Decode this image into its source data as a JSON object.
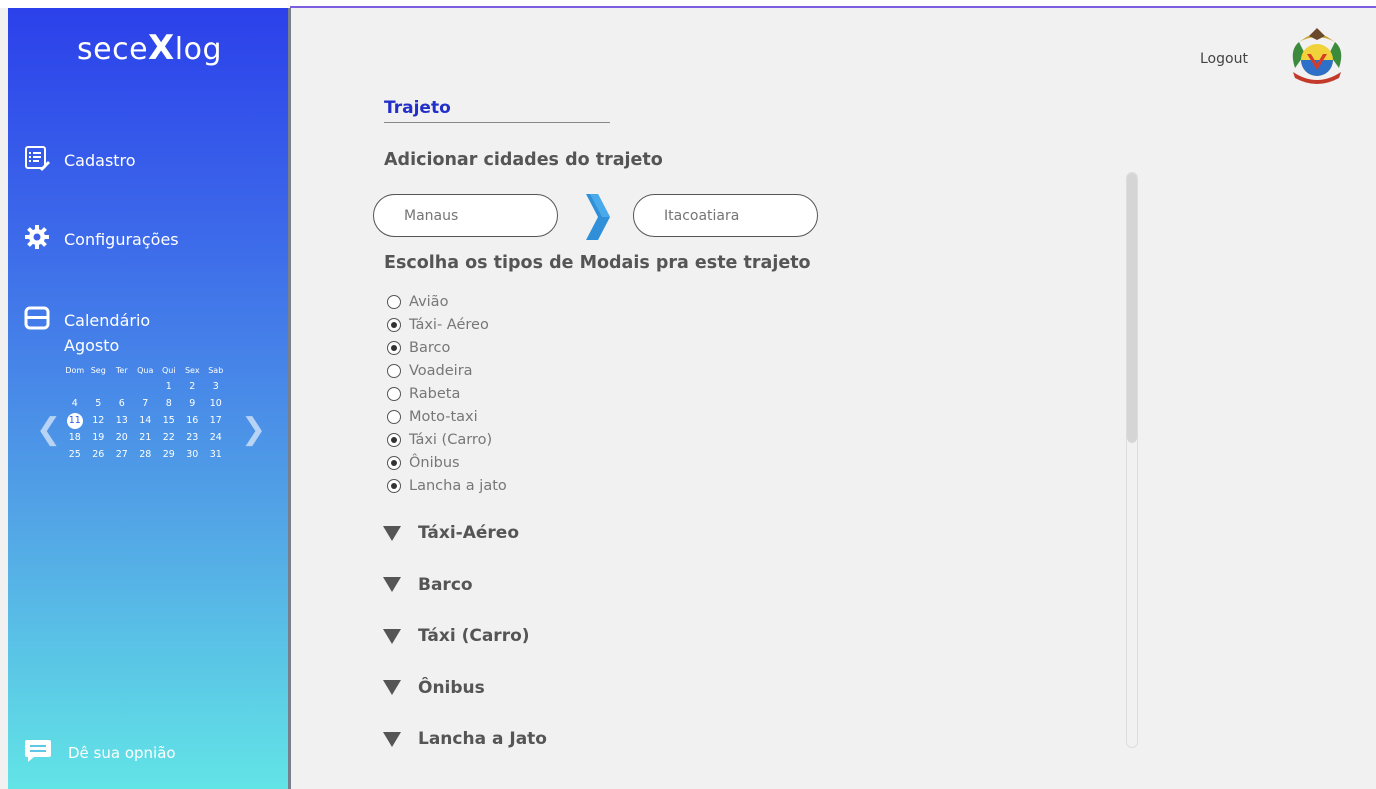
{
  "app": {
    "logo_prefix": "sece",
    "logo_x": "X",
    "logo_suffix": "log"
  },
  "sidebar": {
    "items": [
      {
        "label": "Cadastro",
        "icon": "form-list-icon"
      },
      {
        "label": "Configurações",
        "icon": "gear-icon"
      },
      {
        "label": "Calendário",
        "icon": "calendar-icon"
      }
    ],
    "feedback_label": "Dê sua opnião"
  },
  "calendar": {
    "month": "Agosto",
    "weekdays": [
      "Dom",
      "Seg",
      "Ter",
      "Qua",
      "Qui",
      "Sex",
      "Sab"
    ],
    "weeks": [
      [
        "",
        "",
        "",
        "",
        "1",
        "2",
        "3"
      ],
      [
        "4",
        "5",
        "6",
        "7",
        "8",
        "9",
        "10"
      ],
      [
        "11",
        "12",
        "13",
        "14",
        "15",
        "16",
        "17"
      ],
      [
        "18",
        "19",
        "20",
        "21",
        "22",
        "23",
        "24"
      ],
      [
        "25",
        "26",
        "27",
        "28",
        "29",
        "30",
        "31"
      ]
    ],
    "today": "11"
  },
  "header": {
    "logout_label": "Logout"
  },
  "main": {
    "title": "Trajeto",
    "cities_heading": "Adicionar cidades do trajeto",
    "origin": {
      "placeholder": "Manaus"
    },
    "destination": {
      "placeholder": "Itacoatiara"
    },
    "modals_heading": "Escolha os tipos de Modais pra este trajeto",
    "modal_options": [
      {
        "label": "Avião",
        "checked": false
      },
      {
        "label": "Táxi- Aéreo",
        "checked": true
      },
      {
        "label": "Barco",
        "checked": true
      },
      {
        "label": "Voadeira",
        "checked": false
      },
      {
        "label": "Rabeta",
        "checked": false
      },
      {
        "label": "Moto-taxi",
        "checked": false
      },
      {
        "label": "Táxi (Carro)",
        "checked": true
      },
      {
        "label": "Ônibus",
        "checked": true
      },
      {
        "label": "Lancha a jato",
        "checked": true
      }
    ],
    "sections": [
      "Táxi-Aéreo",
      "Barco",
      "Táxi (Carro)",
      "Ônibus",
      "Lancha a Jato"
    ]
  },
  "colors": {
    "sidebar_top": "#2b40ea",
    "sidebar_bottom": "#62e4e6",
    "title_blue": "#2230c9",
    "chevron_blue": "#2f8fd8"
  }
}
